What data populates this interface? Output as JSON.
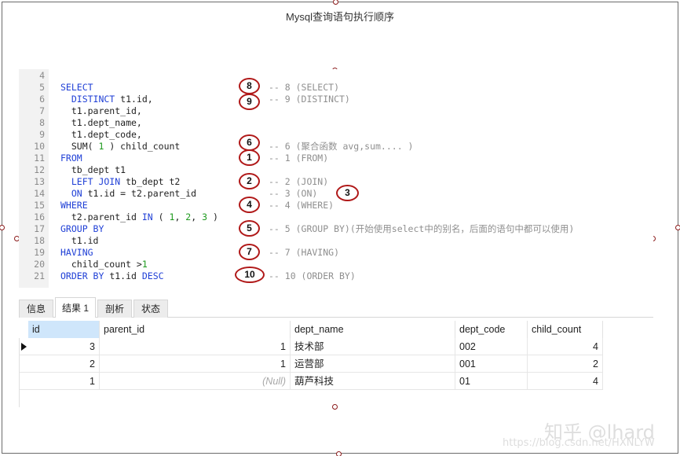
{
  "title": "Mysql查询语句执行顺序",
  "editor": {
    "lines": [
      {
        "n": "4",
        "code": [],
        "comment": ""
      },
      {
        "n": "5",
        "code": [
          {
            "t": "SELECT",
            "k": "kw"
          }
        ],
        "comment": "-- 8 (SELECT)"
      },
      {
        "n": "6",
        "code": [
          {
            "t": "  DISTINCT",
            "k": "kw"
          },
          {
            "t": " t1.id,",
            "k": "tx"
          }
        ],
        "comment": "-- 9 (DISTINCT)"
      },
      {
        "n": "7",
        "code": [
          {
            "t": "  t1.parent_id,",
            "k": "tx"
          }
        ],
        "comment": ""
      },
      {
        "n": "8",
        "code": [
          {
            "t": "  t1.dept_name,",
            "k": "tx"
          }
        ],
        "comment": ""
      },
      {
        "n": "9",
        "code": [
          {
            "t": "  t1.dept_code,",
            "k": "tx"
          }
        ],
        "comment": ""
      },
      {
        "n": "10",
        "code": [
          {
            "t": "  SUM( ",
            "k": "tx"
          },
          {
            "t": "1",
            "k": "num"
          },
          {
            "t": " ) child_count",
            "k": "tx"
          }
        ],
        "comment": "-- 6 (聚合函数 avg,sum.... )"
      },
      {
        "n": "11",
        "code": [
          {
            "t": "FROM",
            "k": "kw"
          }
        ],
        "comment": "-- 1 (FROM)"
      },
      {
        "n": "12",
        "code": [
          {
            "t": "  tb_dept t1",
            "k": "tx"
          }
        ],
        "comment": ""
      },
      {
        "n": "13",
        "code": [
          {
            "t": "  LEFT JOIN",
            "k": "kw"
          },
          {
            "t": " tb_dept t2",
            "k": "tx"
          }
        ],
        "comment": "-- 2 (JOIN)"
      },
      {
        "n": "14",
        "code": [
          {
            "t": "  ON",
            "k": "kw"
          },
          {
            "t": " t1.id = t2.parent_id",
            "k": "tx"
          }
        ],
        "comment": "-- 3 (ON)"
      },
      {
        "n": "15",
        "code": [
          {
            "t": "WHERE",
            "k": "kw"
          }
        ],
        "comment": "-- 4 (WHERE)"
      },
      {
        "n": "16",
        "code": [
          {
            "t": "  t2.parent_id ",
            "k": "tx"
          },
          {
            "t": "IN",
            "k": "kw"
          },
          {
            "t": " ( ",
            "k": "tx"
          },
          {
            "t": "1",
            "k": "num"
          },
          {
            "t": ", ",
            "k": "tx"
          },
          {
            "t": "2",
            "k": "num"
          },
          {
            "t": ", ",
            "k": "tx"
          },
          {
            "t": "3",
            "k": "num"
          },
          {
            "t": " )",
            "k": "tx"
          }
        ],
        "comment": ""
      },
      {
        "n": "17",
        "code": [
          {
            "t": "GROUP BY",
            "k": "kw"
          }
        ],
        "comment": "-- 5 (GROUP BY)(开始使用select中的别名，后面的语句中都可以使用)"
      },
      {
        "n": "18",
        "code": [
          {
            "t": "  t1.id",
            "k": "tx"
          }
        ],
        "comment": ""
      },
      {
        "n": "19",
        "code": [
          {
            "t": "HAVING",
            "k": "kw"
          }
        ],
        "comment": "-- 7 (HAVING)"
      },
      {
        "n": "20",
        "code": [
          {
            "t": "  child_count >",
            "k": "tx"
          },
          {
            "t": "1",
            "k": "num"
          }
        ],
        "comment": ""
      },
      {
        "n": "21",
        "code": [
          {
            "t": "ORDER BY",
            "k": "kw"
          },
          {
            "t": " t1.id ",
            "k": "tx"
          },
          {
            "t": "DESC",
            "k": "kw"
          }
        ],
        "comment": "-- 10 (ORDER BY)"
      }
    ]
  },
  "step_markers": [
    "8",
    "9",
    "6",
    "1",
    "2",
    "3",
    "4",
    "5",
    "7",
    "10"
  ],
  "tabs": [
    "信息",
    "结果 1",
    "剖析",
    "状态"
  ],
  "active_tab": "结果 1",
  "grid": {
    "columns": [
      "id",
      "parent_id",
      "dept_name",
      "dept_code",
      "child_count"
    ],
    "rows": [
      [
        "3",
        "1",
        "技术部",
        "002",
        "4"
      ],
      [
        "2",
        "1",
        "运营部",
        "001",
        "2"
      ],
      [
        "1",
        "(Null)",
        "葫芦科技",
        "01",
        "4"
      ]
    ]
  },
  "watermark": {
    "brand": "知乎 @lhard",
    "url": "https://blog.csdn.net/HXNLYW"
  },
  "colors": {
    "keyword": "#1f3fd6",
    "number": "#1e9a1e",
    "comment": "#8f8f8f",
    "marker": "#b01818",
    "selected_header": "#cfe6fb"
  }
}
